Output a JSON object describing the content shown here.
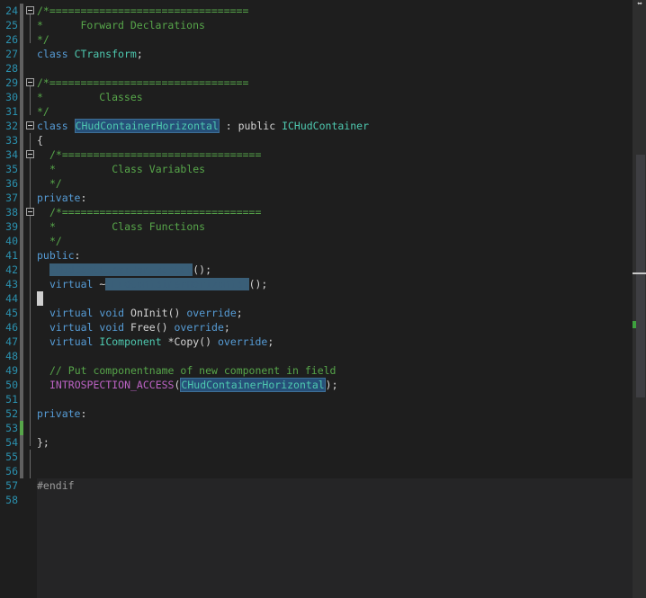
{
  "editor": {
    "lines": [
      {
        "num": "24"
      },
      {
        "num": "25"
      },
      {
        "num": "26"
      },
      {
        "num": "27"
      },
      {
        "num": "28"
      },
      {
        "num": "29"
      },
      {
        "num": "30"
      },
      {
        "num": "31"
      },
      {
        "num": "32"
      },
      {
        "num": "33"
      },
      {
        "num": "34"
      },
      {
        "num": "35"
      },
      {
        "num": "36"
      },
      {
        "num": "37"
      },
      {
        "num": "38"
      },
      {
        "num": "39"
      },
      {
        "num": "40"
      },
      {
        "num": "41"
      },
      {
        "num": "42"
      },
      {
        "num": "43"
      },
      {
        "num": "44"
      },
      {
        "num": "45"
      },
      {
        "num": "46"
      },
      {
        "num": "47"
      },
      {
        "num": "48"
      },
      {
        "num": "49"
      },
      {
        "num": "50"
      },
      {
        "num": "51"
      },
      {
        "num": "52"
      },
      {
        "num": "53"
      },
      {
        "num": "54"
      },
      {
        "num": "55"
      },
      {
        "num": "56"
      },
      {
        "num": "57"
      },
      {
        "num": "58"
      }
    ],
    "text": {
      "sep": "/*================================",
      "sep2": "*=================================",
      "forward_decl": "*      Forward Declarations",
      "comment_end": "*/",
      "class_kw": "class",
      "ctransform": "CTransform",
      "semicolon": ";",
      "classes": "*         Classes",
      "class_name": "CHudContainerHorizontal",
      "colon_public": " : public ",
      "base_class": "ICHudContainer",
      "brace_open": "{",
      "class_variables": "*         Class Variables",
      "private": "private",
      "colon": ":",
      "class_functions": "*         Class Functions",
      "public": "public",
      "ctor_call": "();",
      "virtual": "virtual",
      "tilde": " ~",
      "void": "void",
      "oninit": " OnInit() ",
      "override": "override",
      "free": " Free() ",
      "icomponent": "IComponent",
      "copy": " *Copy() ",
      "field_comment": "// Put componentname of new component in field",
      "introspection": "INTROSPECTION_ACCESS",
      "paren_open": "(",
      "paren_close_semi": ");",
      "brace_close": "};",
      "endif": "#endif"
    }
  },
  "colors": {
    "background": "#1e1e1e",
    "line_number": "#2b91af",
    "keyword": "#569cd6",
    "type": "#4ec9b0",
    "comment": "#57a64a",
    "macro": "#bd63c5",
    "selection": "#264f78"
  },
  "icons": {
    "split": "split-handle-icon"
  }
}
